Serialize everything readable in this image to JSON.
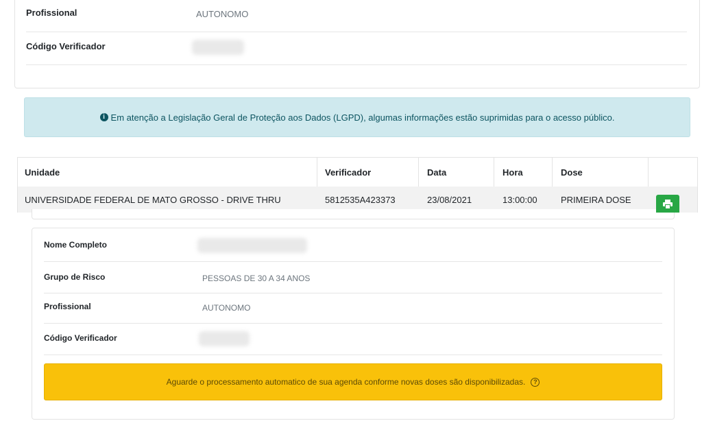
{
  "top_card": {
    "profissional_label": "Profissional",
    "profissional_value": "AUTONOMO",
    "codigo_label": "Código Verificador"
  },
  "info_alert": {
    "icon": "info-circle-icon",
    "text": "Em atenção a Legislação Geral de Proteção aos Dados (LGPD), algumas informações estão suprimidas para o acesso público."
  },
  "table": {
    "headers": [
      "Unidade",
      "Verificador",
      "Data",
      "Hora",
      "Dose",
      ""
    ],
    "rows": [
      {
        "unidade": "UNIVERSIDADE FEDERAL DE MATO GROSSO - DRIVE THRU",
        "verificador": "5812535A423373",
        "data": "23/08/2021",
        "hora": "13:00:00",
        "dose": "PRIMEIRA DOSE",
        "action_icon": "print-icon"
      }
    ]
  },
  "detail_card": {
    "nome_label": "Nome Completo",
    "grupo_label": "Grupo de Risco",
    "grupo_value": "PESSOAS DE 30 A 34 ANOS",
    "profissional_label": "Profissional",
    "profissional_value": "AUTONOMO",
    "codigo_label": "Código Verificador"
  },
  "warning_alert": {
    "text": "Aguarde o processamento automatico de sua agenda conforme novas doses são disponibilizadas.",
    "icon": "question-circle-icon",
    "color": "#f9c10a"
  },
  "colors": {
    "info_bg": "#cfe9ee",
    "print_button": "#28a745"
  }
}
